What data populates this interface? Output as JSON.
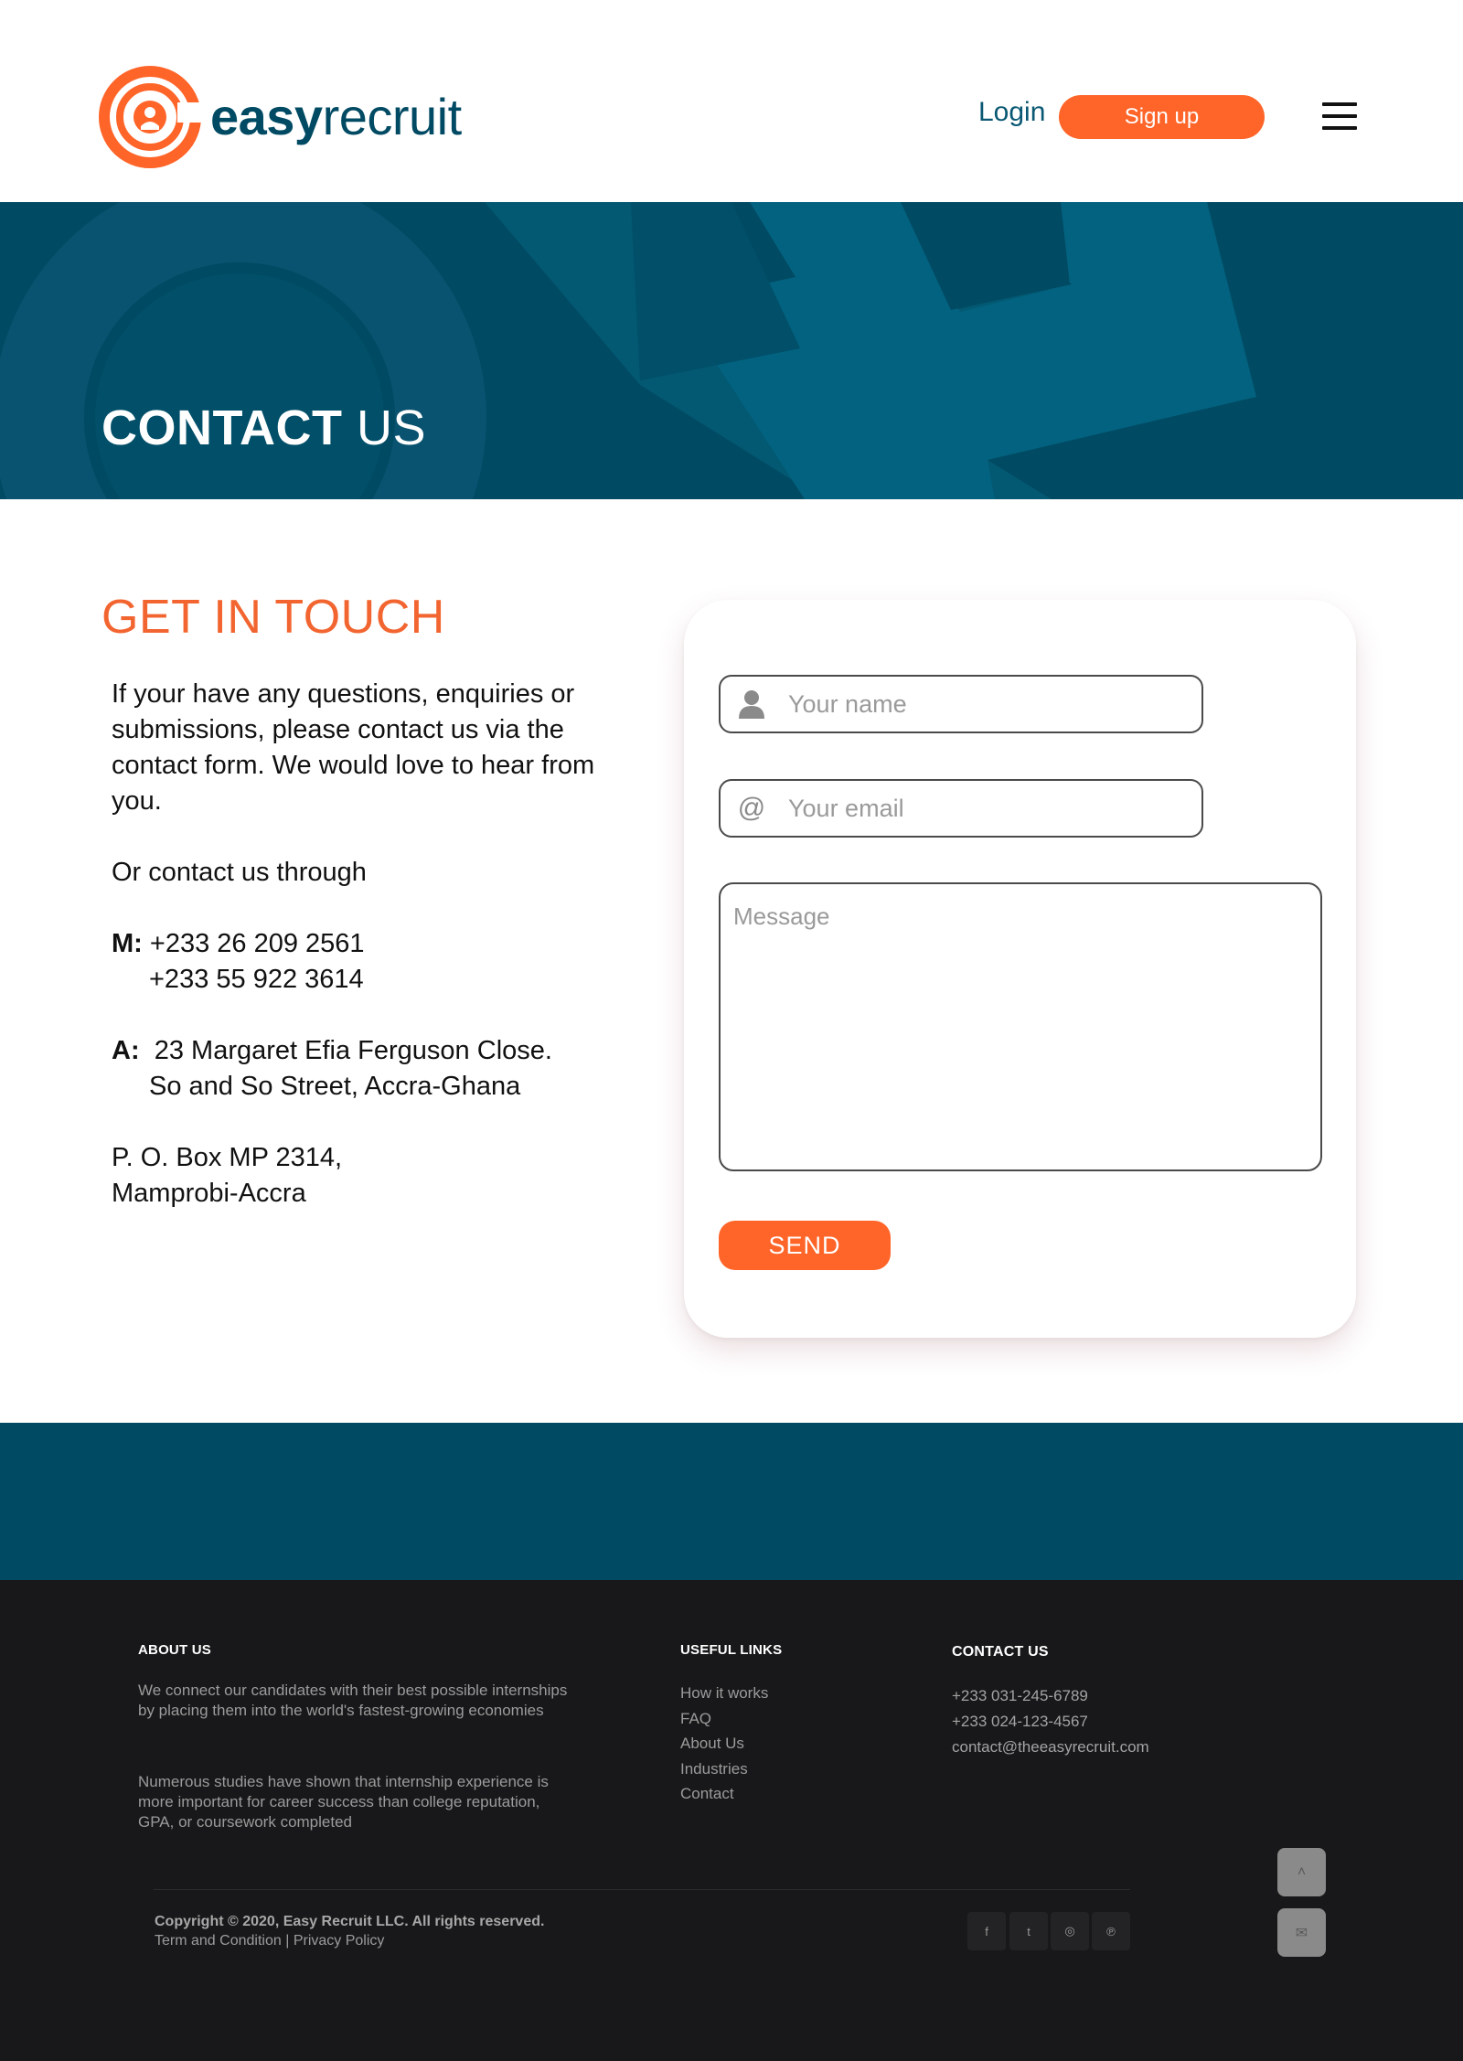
{
  "header": {
    "logo_bold": "easy",
    "logo_light": "recruit",
    "login_label": "Login",
    "signup_label": "Sign up"
  },
  "hero": {
    "title_bold": "CONTACT",
    "title_light": "US"
  },
  "contact": {
    "heading": "GET IN TOUCH",
    "intro": "If your have any questions, enquiries or submissions, please contact us via the contact form. We would love to hear from you.",
    "through": "Or contact us through",
    "phone_label": "M:",
    "phone_1": "+233 26 209 2561",
    "phone_2": "+233 55 922 3614",
    "address_label": "A:",
    "address_1": "23 Margaret Efia Ferguson Close.",
    "address_2": "So and So Street, Accra-Ghana",
    "pobox_1": "P. O. Box MP 2314,",
    "pobox_2": "Mamprobi-Accra"
  },
  "form": {
    "name_placeholder": "Your name",
    "name_icon": "user-icon",
    "email_placeholder": "Your email",
    "email_icon": "at-icon",
    "email_icon_glyph": "@",
    "message_placeholder": "Message",
    "send_label": "SEND"
  },
  "footer": {
    "about_heading": "ABOUT US",
    "about_text_1": "We connect our candidates with their best possible internships by placing them into the world's fastest-growing economies",
    "about_text_2": "Numerous studies have shown that internship experience is more important for career success than college reputation, GPA, or coursework completed",
    "links_heading": "USEFUL LINKS",
    "links": [
      "How it works",
      "FAQ",
      "About Us",
      "Industries",
      "Contact"
    ],
    "contact_heading": "CONTACT US",
    "contact_items": [
      "+233 031-245-6789",
      "+233 024-123-4567",
      "contact@theeasyrecruit.com"
    ],
    "copyright": "Copyright © 2020, Easy Recruit LLC. All rights reserved.",
    "terms": "Term and Condition",
    "separator": "|",
    "privacy": "Privacy Policy",
    "social": [
      {
        "icon": "facebook-icon",
        "glyph": "f"
      },
      {
        "icon": "twitter-icon",
        "glyph": "t"
      },
      {
        "icon": "instagram-icon",
        "glyph": "◎"
      },
      {
        "icon": "pinterest-icon",
        "glyph": "℗"
      }
    ],
    "scroll_top_glyph": "˄",
    "mail_glyph": "✉"
  },
  "colors": {
    "brand_orange": "#ff6428",
    "brand_navy": "#014a63",
    "footer_bg": "#18181a"
  }
}
